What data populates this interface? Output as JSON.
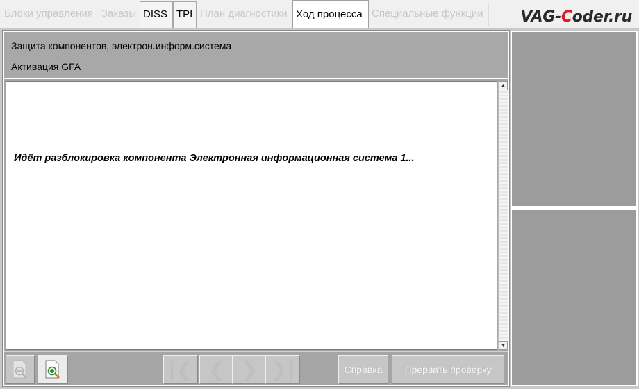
{
  "tabs": [
    {
      "label": "Блоки управления",
      "state": "disabled"
    },
    {
      "label": "Заказы",
      "state": "disabled"
    },
    {
      "label": "DISS",
      "state": "enabled"
    },
    {
      "label": "TPI",
      "state": "enabled"
    },
    {
      "label": "План диагностики",
      "state": "disabled"
    },
    {
      "label": "Ход процесса",
      "state": "active"
    },
    {
      "label": "Специальные функции",
      "state": "disabled"
    }
  ],
  "watermark": {
    "prefix": "VAG-",
    "accent": "C",
    "suffix": "oder.ru",
    "accent_color": "#d71f1f"
  },
  "header": {
    "line1": "Защита компонентов, электрон.информ.система",
    "line2": "Активация GFA"
  },
  "content": {
    "message": "Идёт разблокировка компонента Электронная информационная система 1..."
  },
  "toolbar": {
    "zoom_out_icon": "zoom-out-icon",
    "zoom_in_icon": "zoom-in-icon",
    "first_icon": "first-page-icon",
    "prev_icon": "prev-icon",
    "next_icon": "next-icon",
    "last_icon": "last-page-icon",
    "help_label": "Справка",
    "abort_label": "Прервать проверку"
  }
}
